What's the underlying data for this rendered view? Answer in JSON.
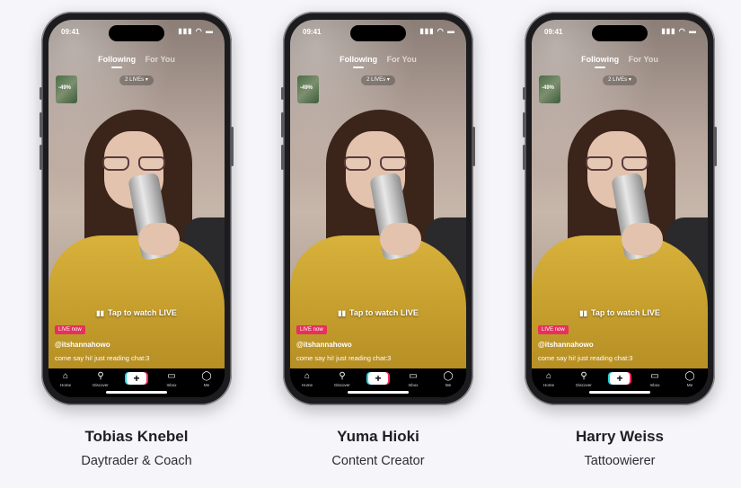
{
  "cards": [
    {
      "name": "Tobias Knebel",
      "role": "Daytrader & Coach",
      "phone": {
        "time": "09:41",
        "tabs": [
          "Following",
          "For You"
        ],
        "lives_label": "2 LIVEs ▾",
        "thumb_badge": "-49%",
        "tap_label": "Tap to watch LIVE",
        "live_badge": "LIVE now",
        "username": "@itshannahowo",
        "caption": "come say hi! just reading chat:3",
        "nav": [
          "Home",
          "Discover",
          "+",
          "Inbox",
          "Me"
        ]
      }
    },
    {
      "name": "Yuma Hioki",
      "role": "Content Creator",
      "phone": {
        "time": "09:41",
        "tabs": [
          "Following",
          "For You"
        ],
        "lives_label": "2 LIVEs ▾",
        "thumb_badge": "-49%",
        "tap_label": "Tap to watch LIVE",
        "live_badge": "LIVE now",
        "username": "@itshannahowo",
        "caption": "come say hi! just reading chat:3",
        "nav": [
          "Home",
          "Discover",
          "+",
          "Inbox",
          "Me"
        ]
      }
    },
    {
      "name": "Harry Weiss",
      "role": "Tattoowierer",
      "phone": {
        "time": "09:41",
        "tabs": [
          "Following",
          "For You"
        ],
        "lives_label": "2 LIVEs ▾",
        "thumb_badge": "-49%",
        "tap_label": "Tap to watch LIVE",
        "live_badge": "LIVE now",
        "username": "@itshannahowo",
        "caption": "come say hi! just reading chat:3",
        "nav": [
          "Home",
          "Discover",
          "+",
          "Inbox",
          "Me"
        ]
      }
    }
  ],
  "colors": {
    "background": "#f6f6fa",
    "live_badge": "#e5315d",
    "name_text": "#1f1f28",
    "accent_cyan": "#24d4e4",
    "accent_pink": "#f2295b"
  },
  "icons": {
    "status": [
      "signal-icon",
      "wifi-icon",
      "battery-icon"
    ],
    "nav": [
      "home-icon",
      "search-icon",
      "plus-icon",
      "inbox-icon",
      "profile-icon"
    ]
  }
}
